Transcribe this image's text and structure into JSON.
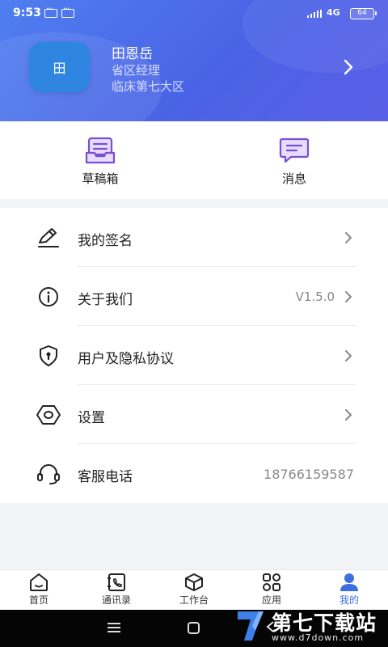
{
  "status_bar": {
    "time": "9:53",
    "network": "4G",
    "battery": "64"
  },
  "profile": {
    "avatar_text": "田",
    "name": "田恩岳",
    "role": "省区经理",
    "department": "临床第七大区"
  },
  "quick_actions": [
    {
      "label": "草稿箱",
      "icon": "drafts-tray-icon"
    },
    {
      "label": "消息",
      "icon": "message-icon"
    }
  ],
  "menu": [
    {
      "label": "我的签名",
      "value": "",
      "icon": "signature-pen-icon"
    },
    {
      "label": "关于我们",
      "value": "V1.5.0",
      "icon": "info-icon"
    },
    {
      "label": "用户及隐私协议",
      "value": "",
      "icon": "shield-lock-icon"
    },
    {
      "label": "设置",
      "value": "",
      "icon": "settings-hexagon-icon"
    },
    {
      "label": "客服电话",
      "value": "18766159587",
      "icon": "headset-icon"
    }
  ],
  "tabs": [
    {
      "label": "首页",
      "icon": "home-icon"
    },
    {
      "label": "通讯录",
      "icon": "contacts-icon"
    },
    {
      "label": "工作台",
      "icon": "workbench-box-icon"
    },
    {
      "label": "应用",
      "icon": "apps-grid-icon"
    },
    {
      "label": "我的",
      "icon": "user-icon"
    }
  ],
  "active_tab": "我的",
  "watermark": {
    "text": "第七下载站",
    "url": "www.d7down.com"
  },
  "colors": {
    "header": "#4a63e6",
    "accent": "#3d6fe0",
    "quick_icon": "#7a4fd6",
    "avatar": "#2e86e0"
  }
}
